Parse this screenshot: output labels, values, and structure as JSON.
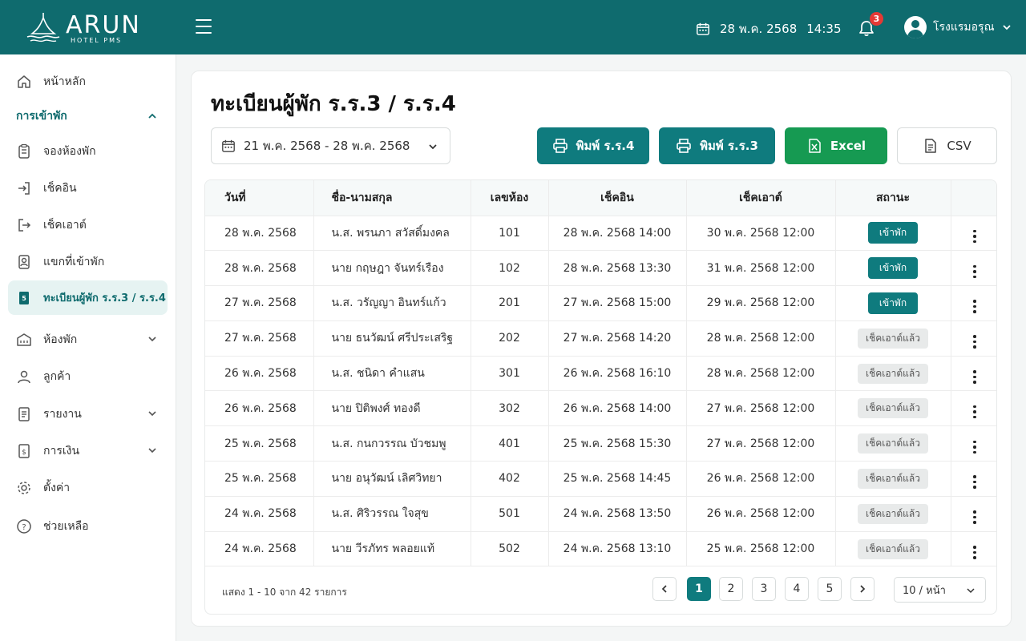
{
  "brand": {
    "name": "ARUN",
    "sub": "HOTEL PMS"
  },
  "header": {
    "date": "28 พ.ค. 2568",
    "time": "14:35",
    "notifications": "3",
    "user": "โรงแรมอรุณ"
  },
  "sidebar": {
    "home": "หน้าหลัก",
    "group_label": "การเข้าพัก",
    "items": [
      {
        "label": "จองห้องพัก",
        "icon": "booking-icon"
      },
      {
        "label": "เช็คอิน",
        "icon": "check-in-icon"
      },
      {
        "label": "เช็คเอาต์",
        "icon": "check-out-icon"
      },
      {
        "label": "แขกที่เข้าพัก",
        "icon": "guest-badge-icon"
      },
      {
        "label": "ทะเบียนผู้พัก ร.ร.3 / ร.ร.4",
        "icon": "register-book-icon"
      }
    ],
    "rooms": "ห้องพัก",
    "customers": "ลูกค้า",
    "reports": "รายงาน",
    "finance": "การเงิน",
    "settings": "ตั้งค่า",
    "help": "ช่วยเหลือ"
  },
  "page": {
    "title": "ทะเบียนผู้พัก ร.ร.3 / ร.ร.4",
    "date_range": "21 พ.ค. 2568 - 28 พ.ค. 2568",
    "btn_print4": "พิมพ์ ร.ร.4",
    "btn_print3": "พิมพ์ ร.ร.3",
    "btn_excel": "Excel",
    "btn_csv": "CSV"
  },
  "table": {
    "headers": [
      "วันที่",
      "ชื่อ-นามสกุล",
      "เลขห้อง",
      "เช็คอิน",
      "เช็คเอาต์",
      "สถานะ"
    ],
    "rows": [
      {
        "date": "28 พ.ค. 2568",
        "name": "น.ส. พรนภา สวัสดิ์มงคล",
        "room": "101",
        "checkin": "28 พ.ค. 2568 14:00",
        "checkout": "30 พ.ค. 2568 12:00",
        "status": "เข้าพัก",
        "status_type": "in"
      },
      {
        "date": "28 พ.ค. 2568",
        "name": "นาย กฤษฎา จันทร์เรือง",
        "room": "102",
        "checkin": "28 พ.ค. 2568 13:30",
        "checkout": "31 พ.ค. 2568 12:00",
        "status": "เข้าพัก",
        "status_type": "in"
      },
      {
        "date": "27 พ.ค. 2568",
        "name": "น.ส. วรัญญา อินทร์แก้ว",
        "room": "201",
        "checkin": "27 พ.ค. 2568 15:00",
        "checkout": "29 พ.ค. 2568 12:00",
        "status": "เข้าพัก",
        "status_type": "in"
      },
      {
        "date": "27 พ.ค. 2568",
        "name": "นาย ธนวัฒน์ ศรีประเสริฐ",
        "room": "202",
        "checkin": "27 พ.ค. 2568 14:20",
        "checkout": "28 พ.ค. 2568 12:00",
        "status": "เช็คเอาต์แล้ว",
        "status_type": "out"
      },
      {
        "date": "26 พ.ค. 2568",
        "name": "น.ส. ชนิดา คำแสน",
        "room": "301",
        "checkin": "26 พ.ค. 2568 16:10",
        "checkout": "28 พ.ค. 2568 12:00",
        "status": "เช็คเอาต์แล้ว",
        "status_type": "out"
      },
      {
        "date": "26 พ.ค. 2568",
        "name": "นาย ปิติพงศ์ ทองดี",
        "room": "302",
        "checkin": "26 พ.ค. 2568 14:00",
        "checkout": "27 พ.ค. 2568 12:00",
        "status": "เช็คเอาต์แล้ว",
        "status_type": "out"
      },
      {
        "date": "25 พ.ค. 2568",
        "name": "น.ส. กนกวรรณ บัวชมพู",
        "room": "401",
        "checkin": "25 พ.ค. 2568 15:30",
        "checkout": "27 พ.ค. 2568 12:00",
        "status": "เช็คเอาต์แล้ว",
        "status_type": "out"
      },
      {
        "date": "25 พ.ค. 2568",
        "name": "นาย อนุวัฒน์ เลิศวิทยา",
        "room": "402",
        "checkin": "25 พ.ค. 2568 14:45",
        "checkout": "26 พ.ค. 2568 12:00",
        "status": "เช็คเอาต์แล้ว",
        "status_type": "out"
      },
      {
        "date": "24 พ.ค. 2568",
        "name": "น.ส. ศิริวรรณ ใจสุข",
        "room": "501",
        "checkin": "24 พ.ค. 2568 13:50",
        "checkout": "26 พ.ค. 2568 12:00",
        "status": "เช็คเอาต์แล้ว",
        "status_type": "out"
      },
      {
        "date": "24 พ.ค. 2568",
        "name": "นาย วีรภัทร พลอยแท้",
        "room": "502",
        "checkin": "24 พ.ค. 2568 13:10",
        "checkout": "25 พ.ค. 2568 12:00",
        "status": "เช็คเอาต์แล้ว",
        "status_type": "out"
      }
    ]
  },
  "pagination": {
    "info": "แสดง 1 - 10 จาก 42 รายการ",
    "pages": [
      "1",
      "2",
      "3",
      "4",
      "5"
    ],
    "current": "1",
    "per_page": "10 / หน้า"
  },
  "colors": {
    "brand": "#0f6b6e",
    "button_teal": "#0f7b7e",
    "excel": "#169a52",
    "badge_alert": "#e53935"
  }
}
